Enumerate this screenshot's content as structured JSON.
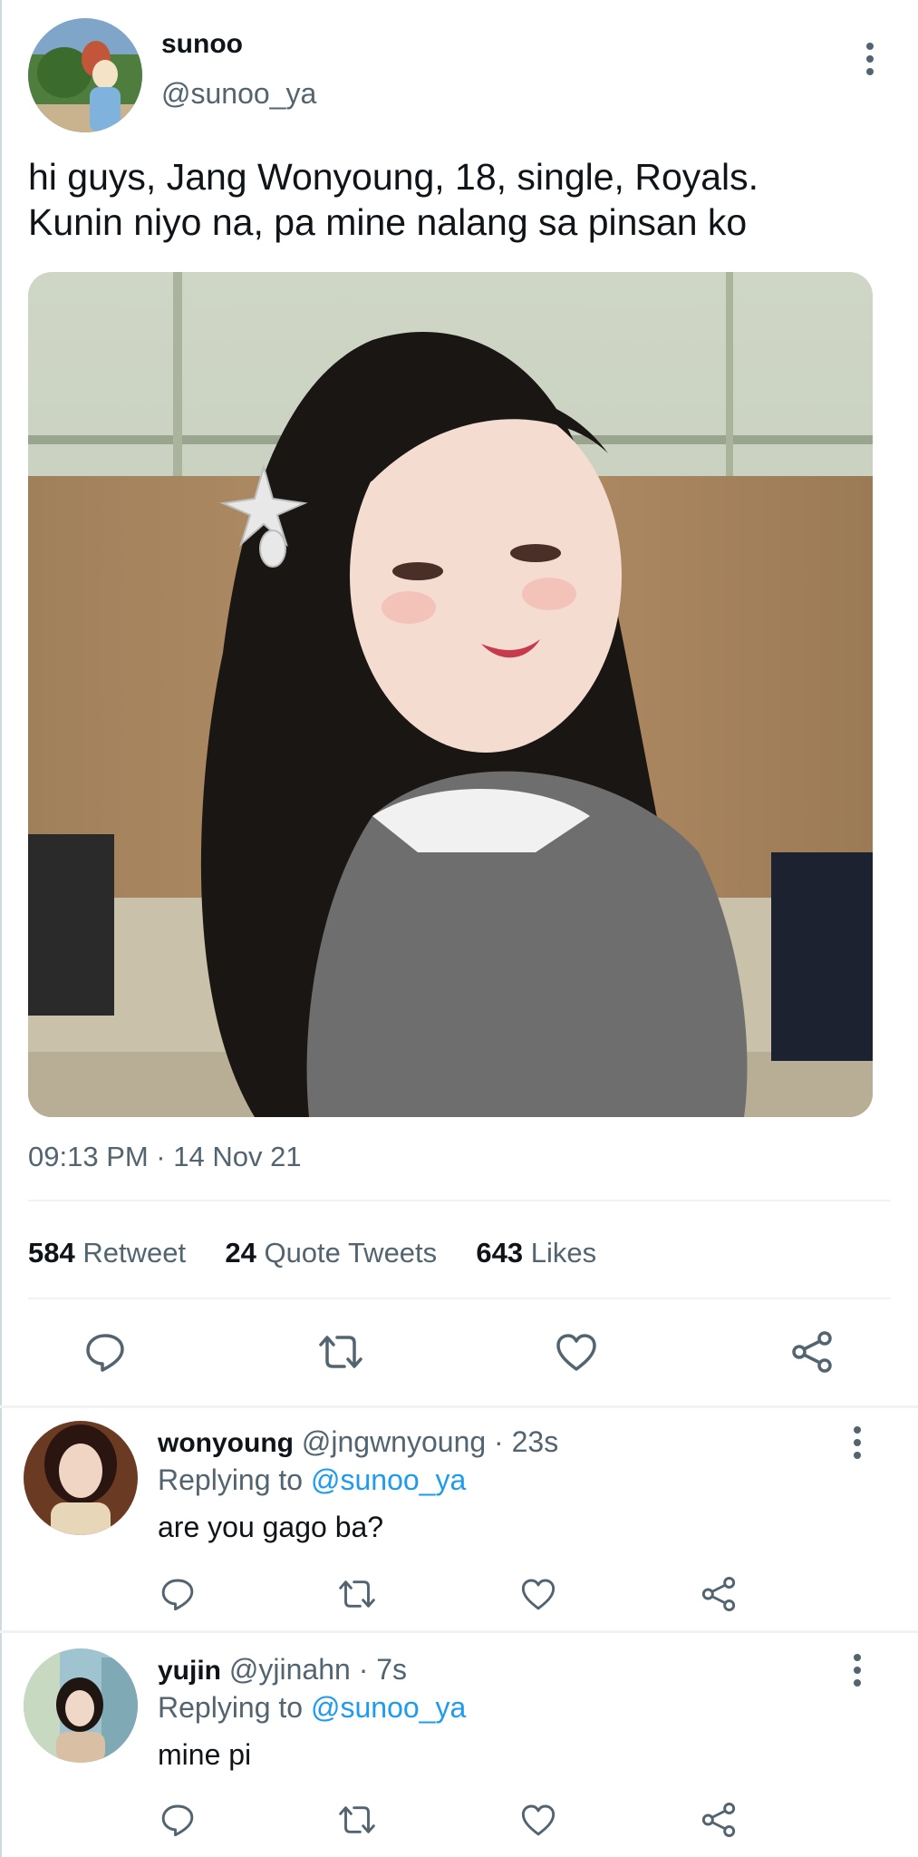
{
  "tweet": {
    "author": {
      "name": "sunoo",
      "handle": "@sunoo_ya"
    },
    "text_line1": "hi guys, Jang Wonyoung, 18, single, Royals.",
    "text_line2": "Kunin niyo na, pa mine nalang sa pinsan ko",
    "timestamp": "09:13 PM · 14 Nov 21",
    "stats": {
      "retweets_count": "584",
      "retweets_label": "Retweet",
      "quotes_count": "24",
      "quotes_label": "Quote Tweets",
      "likes_count": "643",
      "likes_label": "Likes"
    }
  },
  "replies": [
    {
      "name": "wonyoung",
      "handle": "@jngwnyoung",
      "time": "· 23s",
      "replying_prefix": "Replying to",
      "replying_handle": "@sunoo_ya",
      "text": "are you gago ba?"
    },
    {
      "name": "yujin",
      "handle": "@yjinahn",
      "time": "· 7s",
      "replying_prefix": "Replying to",
      "replying_handle": "@sunoo_ya",
      "text": "mine pi"
    }
  ],
  "icons": [
    "more-icon",
    "reply-icon",
    "retweet-icon",
    "like-icon",
    "share-icon"
  ],
  "colors": {
    "text": "#0f1419",
    "muted": "#536471",
    "link": "#1d9bf0",
    "divider": "#eff3f4"
  }
}
